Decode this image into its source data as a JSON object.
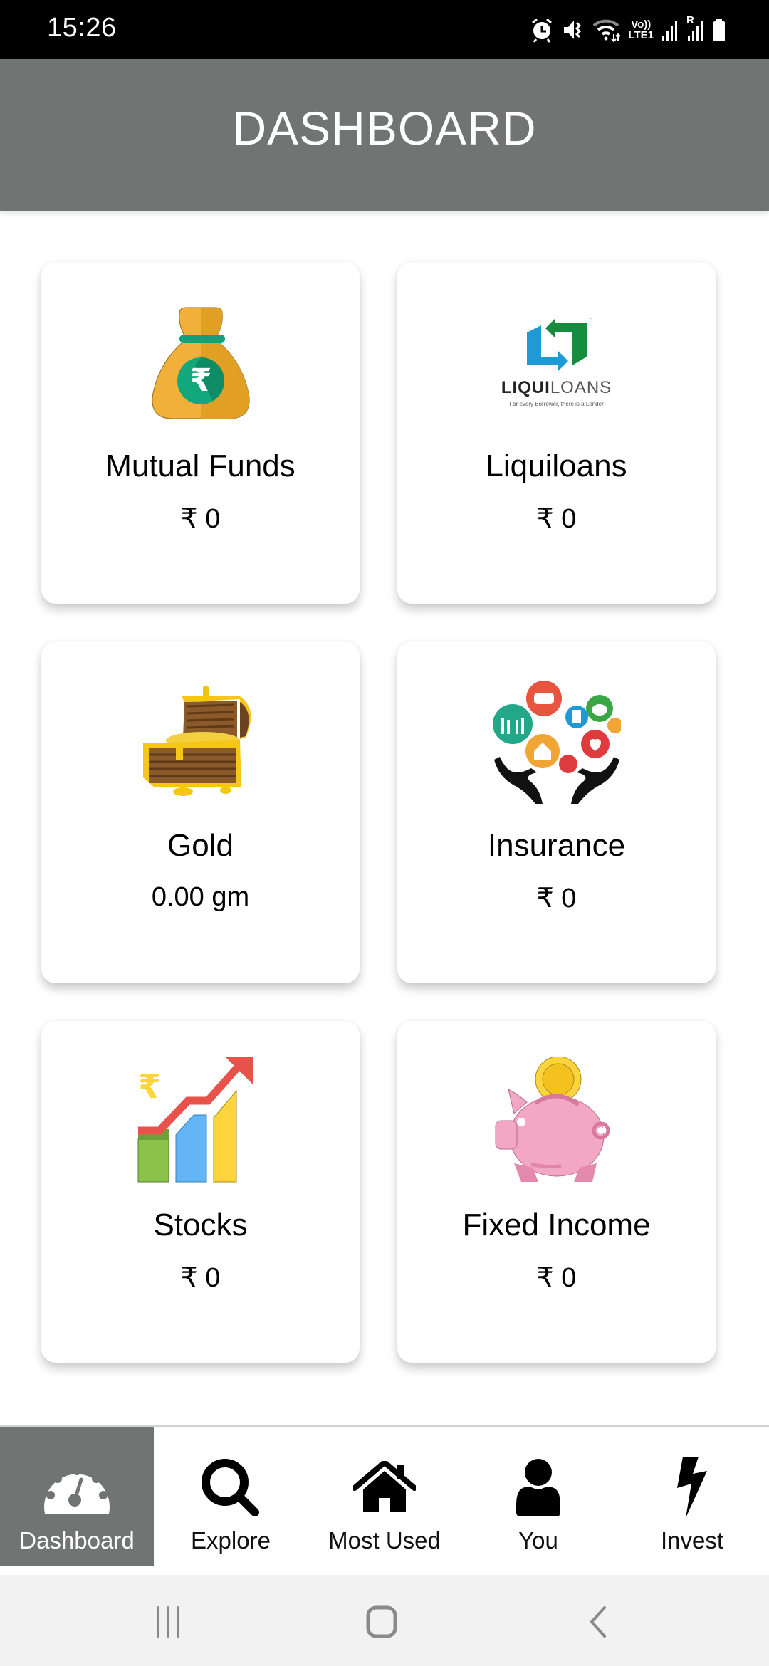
{
  "status_bar": {
    "time": "15:26",
    "icons": [
      "alarm-icon",
      "vibrate-icon",
      "wifi-icon",
      "volte-lte-icon",
      "signal-icon",
      "signal-roaming-icon",
      "battery-icon"
    ],
    "network_label_top": "Vo))",
    "network_label_bottom": "LTE1",
    "roaming_label": "R"
  },
  "header": {
    "title": "DASHBOARD"
  },
  "cards": [
    {
      "id": "mutual-funds",
      "label": "Mutual Funds",
      "value": "₹ 0",
      "icon": "money-bag-icon"
    },
    {
      "id": "liquiloans",
      "label": "Liquiloans",
      "value": "₹ 0",
      "icon": "liquiloans-logo",
      "logo_text_bold": "LIQUI",
      "logo_text_light": "LOANS",
      "logo_tagline": "For every Borrower, there is a Lender",
      "logo_tm": "™"
    },
    {
      "id": "gold",
      "label": "Gold",
      "value": "0.00 gm",
      "icon": "treasure-chest-icon"
    },
    {
      "id": "insurance",
      "label": "Insurance",
      "value": "₹ 0",
      "icon": "insurance-hands-icon"
    },
    {
      "id": "stocks",
      "label": "Stocks",
      "value": "₹ 0",
      "icon": "stocks-growth-chart-icon"
    },
    {
      "id": "fixed-income",
      "label": "Fixed Income",
      "value": "₹ 0",
      "icon": "piggy-bank-icon"
    }
  ],
  "bottom_nav": {
    "items": [
      {
        "label": "Dashboard",
        "icon": "speedometer-icon",
        "active": true
      },
      {
        "label": "Explore",
        "icon": "search-icon",
        "active": false
      },
      {
        "label": "Most Used",
        "icon": "home-icon",
        "active": false
      },
      {
        "label": "You",
        "icon": "user-icon",
        "active": false
      },
      {
        "label": "Invest",
        "icon": "lightning-icon",
        "active": false
      }
    ]
  },
  "system_nav": {
    "buttons": [
      "recent-apps",
      "home",
      "back"
    ]
  },
  "colors": {
    "header_bg": "#707473",
    "active_tab_bg": "#707473",
    "status_bar_bg": "#000000",
    "system_nav_bg": "#f2f2f2"
  }
}
